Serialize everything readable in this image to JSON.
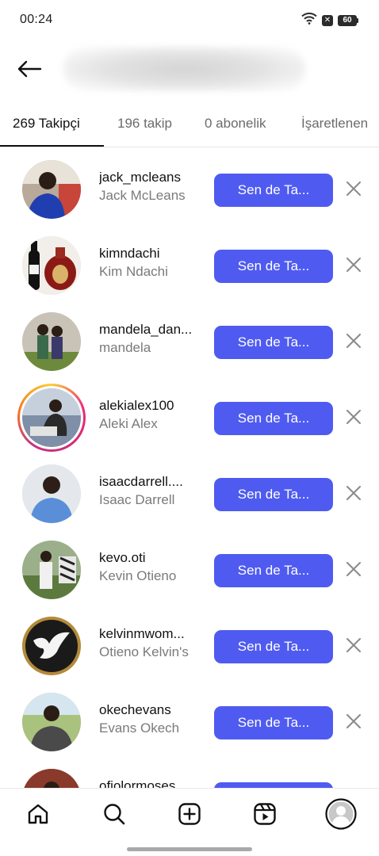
{
  "status_bar": {
    "time": "00:24",
    "battery": "60"
  },
  "header": {
    "back_icon": "arrow-left-icon"
  },
  "tabs": [
    {
      "label": "269 Takipçi",
      "active": true
    },
    {
      "label": "196 takip",
      "active": false
    },
    {
      "label": "0 abonelik",
      "active": false
    },
    {
      "label": "İşaretlenen",
      "active": false
    }
  ],
  "follow_button_label": "Sen de Ta...",
  "followers": [
    {
      "username": "jack_mcleans",
      "full_name": "Jack McLeans"
    },
    {
      "username": "kimndachi",
      "full_name": "Kim Ndachi"
    },
    {
      "username": "mandela_dan...",
      "full_name": "mandela"
    },
    {
      "username": "alekialex100",
      "full_name": "Aleki Alex",
      "has_story": true
    },
    {
      "username": "isaacdarrell....",
      "full_name": "Isaac Darrell"
    },
    {
      "username": "kevo.oti",
      "full_name": "Kevin Otieno"
    },
    {
      "username": "kelvinmwom...",
      "full_name": "Otieno Kelvin's"
    },
    {
      "username": "okechevans",
      "full_name": "Evans Okech"
    },
    {
      "username": "ofiolormoses",
      "full_name": ""
    }
  ],
  "bottom_nav": [
    {
      "icon": "home-icon"
    },
    {
      "icon": "search-icon"
    },
    {
      "icon": "create-icon"
    },
    {
      "icon": "reels-icon"
    },
    {
      "icon": "profile-icon"
    }
  ],
  "colors": {
    "accent": "#4f5bf0",
    "text_primary": "#111111",
    "text_secondary": "#7a7a7a"
  }
}
